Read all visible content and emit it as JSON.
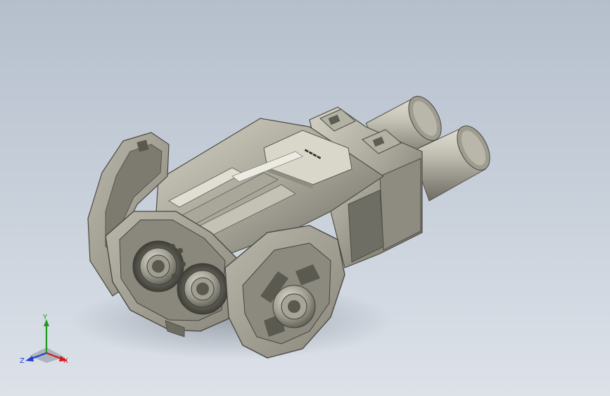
{
  "viewport": {
    "background_top": "#b5bfcc",
    "background_bottom": "#dde2e9"
  },
  "model": {
    "part_color": "#8d8b7d",
    "housing_light": "#c7c5b7",
    "housing_mid": "#a6a497",
    "housing_dark": "#5a594f",
    "cable_light": "#d8d6c9",
    "cable_dark": "#75736a"
  },
  "triad": {
    "x_label": "X",
    "y_label": "Y",
    "z_label": "Z",
    "x_color": "#d01a1a",
    "y_color": "#1f9a1f",
    "z_color": "#1e3fd0"
  }
}
